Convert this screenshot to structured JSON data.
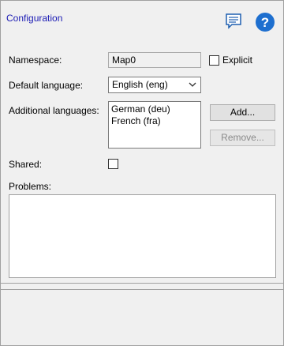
{
  "header": {
    "title": "Configuration",
    "icons": [
      "comment-icon",
      "help-icon"
    ]
  },
  "form": {
    "namespace_label": "Namespace:",
    "namespace_value": "Map0",
    "explicit_label": "Explicit",
    "explicit_checked": false,
    "default_language_label": "Default language:",
    "default_language_value": "English (eng)",
    "additional_languages_label": "Additional languages:",
    "additional_languages": [
      "German (deu)",
      "French (fra)"
    ],
    "add_label": "Add...",
    "remove_label": "Remove...",
    "shared_label": "Shared:",
    "shared_checked": false,
    "problems_label": "Problems:"
  },
  "colors": {
    "accent": "#1a1ab4",
    "help_icon": "#1e6fcf"
  }
}
